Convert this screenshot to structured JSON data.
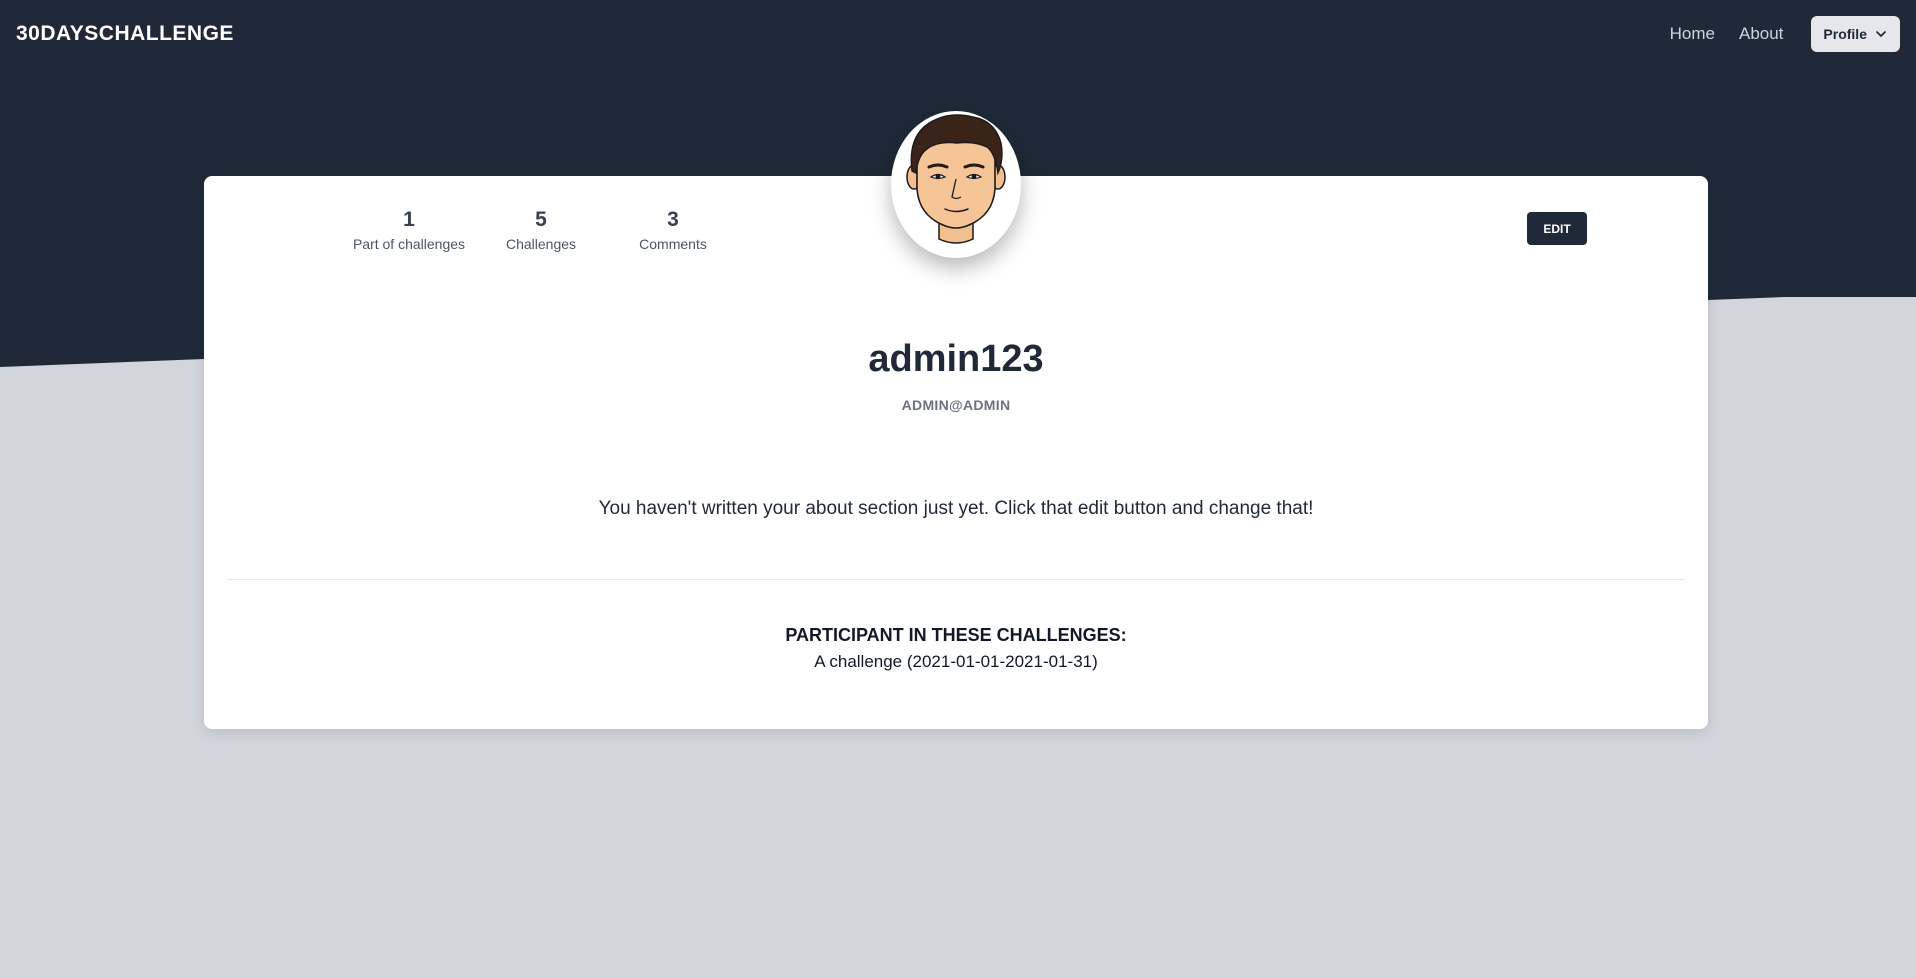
{
  "nav": {
    "brand": "30DAYSCHALLENGE",
    "links": [
      "Home",
      "About"
    ],
    "profile_label": "Profile"
  },
  "profile": {
    "stats": [
      {
        "value": "1",
        "label": "Part of challenges"
      },
      {
        "value": "5",
        "label": "Challenges"
      },
      {
        "value": "3",
        "label": "Comments"
      }
    ],
    "edit_label": "EDIT",
    "username": "admin123",
    "email": "ADMIN@ADMIN",
    "about": "You haven't written your about section just yet. Click that edit button and change that!",
    "participant_title": "PARTICIPANT IN THESE CHALLENGES:",
    "challenges": [
      "A challenge (2021-01-01-2021-01-31)"
    ]
  },
  "colors": {
    "header_bg": "#1f2937",
    "page_bg": "#d1d5dc",
    "card_bg": "#ffffff",
    "button_dark": "#1f2937"
  },
  "icons": [
    "chevron-down-icon",
    "avatar-face"
  ]
}
